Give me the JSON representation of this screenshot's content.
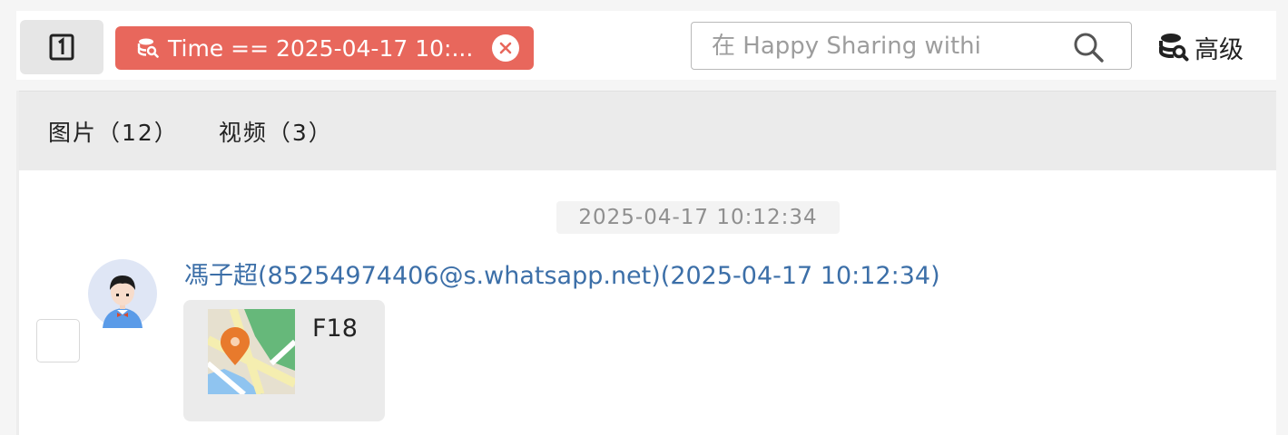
{
  "toolbar": {
    "panel_toggle_icon": "panel-toggle-icon",
    "filter_chip": {
      "icon": "database-search-icon",
      "text": "Time == 2025-04-17 10:...",
      "close_icon": "close-circle-icon",
      "color": "#e8675c"
    },
    "search": {
      "placeholder": "在 Happy Sharing withi",
      "value": "",
      "icon": "search-icon"
    },
    "advanced": {
      "icon": "database-search-icon",
      "label": "高级"
    }
  },
  "tabs": [
    {
      "label": "图片（12）"
    },
    {
      "label": "视频（3）"
    }
  ],
  "conversation": {
    "date_separator": "2025-04-17 10:12:34",
    "messages": [
      {
        "sender": "馮子超(85254974406@s.whatsapp.net)(2025-04-17 10:12:34)",
        "type": "location",
        "location_name": "F18",
        "sender_color": "#3c6fa8"
      }
    ]
  }
}
